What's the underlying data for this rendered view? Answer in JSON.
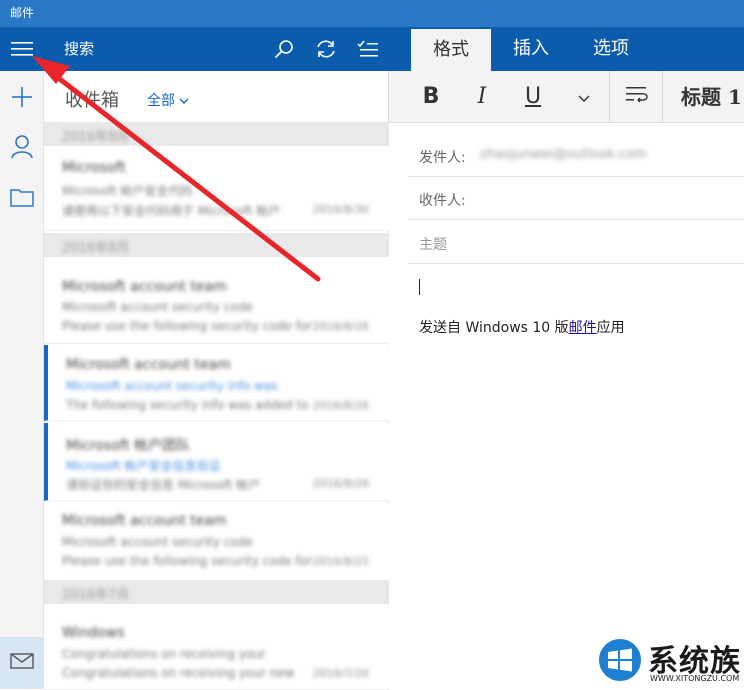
{
  "window": {
    "title": "邮件"
  },
  "rail": {
    "menu_icon": "hamburger-icon",
    "items": [
      {
        "icon": "plus-icon"
      },
      {
        "icon": "person-icon"
      },
      {
        "icon": "folder-icon"
      }
    ],
    "bottom_icon": "mail-icon"
  },
  "search": {
    "label": "搜索"
  },
  "list": {
    "title": "收件箱",
    "filter_label": "全部",
    "groups": [
      "2016年8月",
      "2016年8月",
      "2016年7月"
    ],
    "messages": [
      {
        "sender": "Microsoft",
        "subject": "Microsoft 帐户安全代码",
        "preview": "请使用以下安全代码用于 Microsoft 帐户",
        "date": "2016/8/30"
      },
      {
        "sender": "Microsoft account team",
        "subject": "Microsoft account security code",
        "preview": "Please use the following security code for",
        "date": "2016/8/26"
      },
      {
        "sender": "Microsoft account team",
        "subject": "Microsoft account security info was",
        "preview": "The following security info was added to",
        "date": "2016/8/26"
      },
      {
        "sender": "Microsoft 帐户团队",
        "subject": "Microsoft 帐户安全信息验证",
        "preview": "请验证你的安全信息 Microsoft 帐户",
        "date": "2016/8/26"
      },
      {
        "sender": "Microsoft account team",
        "subject": "Microsoft account security code",
        "preview": "Please use the following security code for",
        "date": "2016/8/25"
      },
      {
        "sender": "Windows",
        "subject": "Congratulations on receiving your",
        "preview": "Congratulations on receiving your new",
        "date": "2016/7/20"
      }
    ]
  },
  "tabs": [
    "格式",
    "插入",
    "选项"
  ],
  "toolbar": {
    "bold": "B",
    "italic": "I",
    "underline": "U",
    "heading_label": "标题 1"
  },
  "compose": {
    "from_label": "发件人:",
    "from_value": "zhaojunwei@outlook.com",
    "to_label": "收件人:",
    "subject_placeholder": "主题",
    "signature_prefix": "发送自 Windows 10 版",
    "signature_link": "邮件",
    "signature_suffix": "应用"
  },
  "watermark": {
    "text": "系统族",
    "url_text": "WWW.XITONGZU.COM"
  },
  "colors": {
    "accent": "#0b5cad",
    "titlebar": "#2b78c6",
    "link": "#1769c4",
    "annotation_arrow": "#e8262a"
  }
}
